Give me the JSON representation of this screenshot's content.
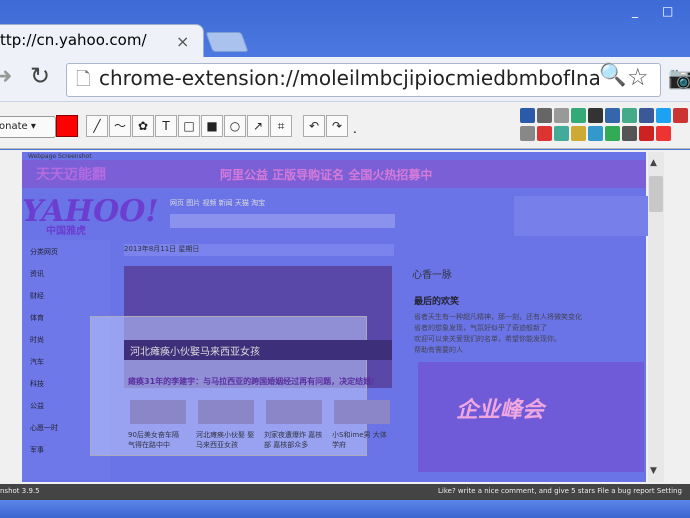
{
  "browser": {
    "tab_title": "ttp://cn.yahoo.com/",
    "tab_close": "×",
    "url": "chrome-extension://moleilmbcjipiocmiedbmbofInaaanfe/c",
    "window_min": "_",
    "window_max": "□"
  },
  "ext_toolbar": {
    "donate_label": "onate",
    "tools": [
      "╱",
      "〜",
      "✿",
      "T",
      "□",
      "■",
      "○",
      "↗",
      "⌗",
      "↶",
      "↷"
    ],
    "dot": ".",
    "share_colors": [
      "#2b5aa8",
      "#666",
      "#999",
      "#3a7",
      "#333",
      "#36a",
      "#4a8",
      "#3b5998",
      "#1da1f2",
      "#c33",
      "#888",
      "#d33",
      "#4a9",
      "#ca3",
      "#39c",
      "#3a5",
      "#555",
      "#c22",
      "#e33"
    ]
  },
  "screenshot": {
    "label": "Webpage Screenshot",
    "banner_text1": "天天迈能翻",
    "banner_text2": "阿里公益 正版导购证名 全国火热招募中",
    "logo": "YAHOO!",
    "logo_sub": "中国雅虎",
    "search_tabs": "网页 图片 视频 新闻 天猫 淘宝",
    "date": "2013年8月11日 星期日",
    "sidebar_items": [
      "分类网页",
      "资讯",
      "财经",
      "体育",
      "时尚",
      "汽车",
      "科技",
      "公益",
      "心愿一时",
      "军事"
    ],
    "hero_caption": "河北瘫痪小伙娶马来西亚女孩",
    "headline": "瘫痪31年的李建宇：与马拉西亚的跨国婚姻经过再有问题，决定结婚/",
    "thumb_captions": [
      "90后美女奋车隔 气得在路中中",
      "河北瘫痪小伙娶 娶马来西亚女孩",
      "刘家夜遭爆炸 嘉核部 嘉核部众多",
      "小S和ime男 大体学府"
    ],
    "hot_header": "心香一脉",
    "hot_title": "最后的欢笑",
    "hot_lines": [
      "省者天生有一种超凡精神，那一刻，还有人将微笑变化",
      "省者的想象发现，气氛好似乎了奇迹般新了",
      "欢迎可以来关爱我们的名单，希望你能发现你。",
      "帮助有需要的人"
    ],
    "promo_text": "企业峰会"
  },
  "status": {
    "left": "nshot 3.9.5",
    "right": "Like? write a nice comment, and give 5 stars     File a bug report     Setting"
  }
}
